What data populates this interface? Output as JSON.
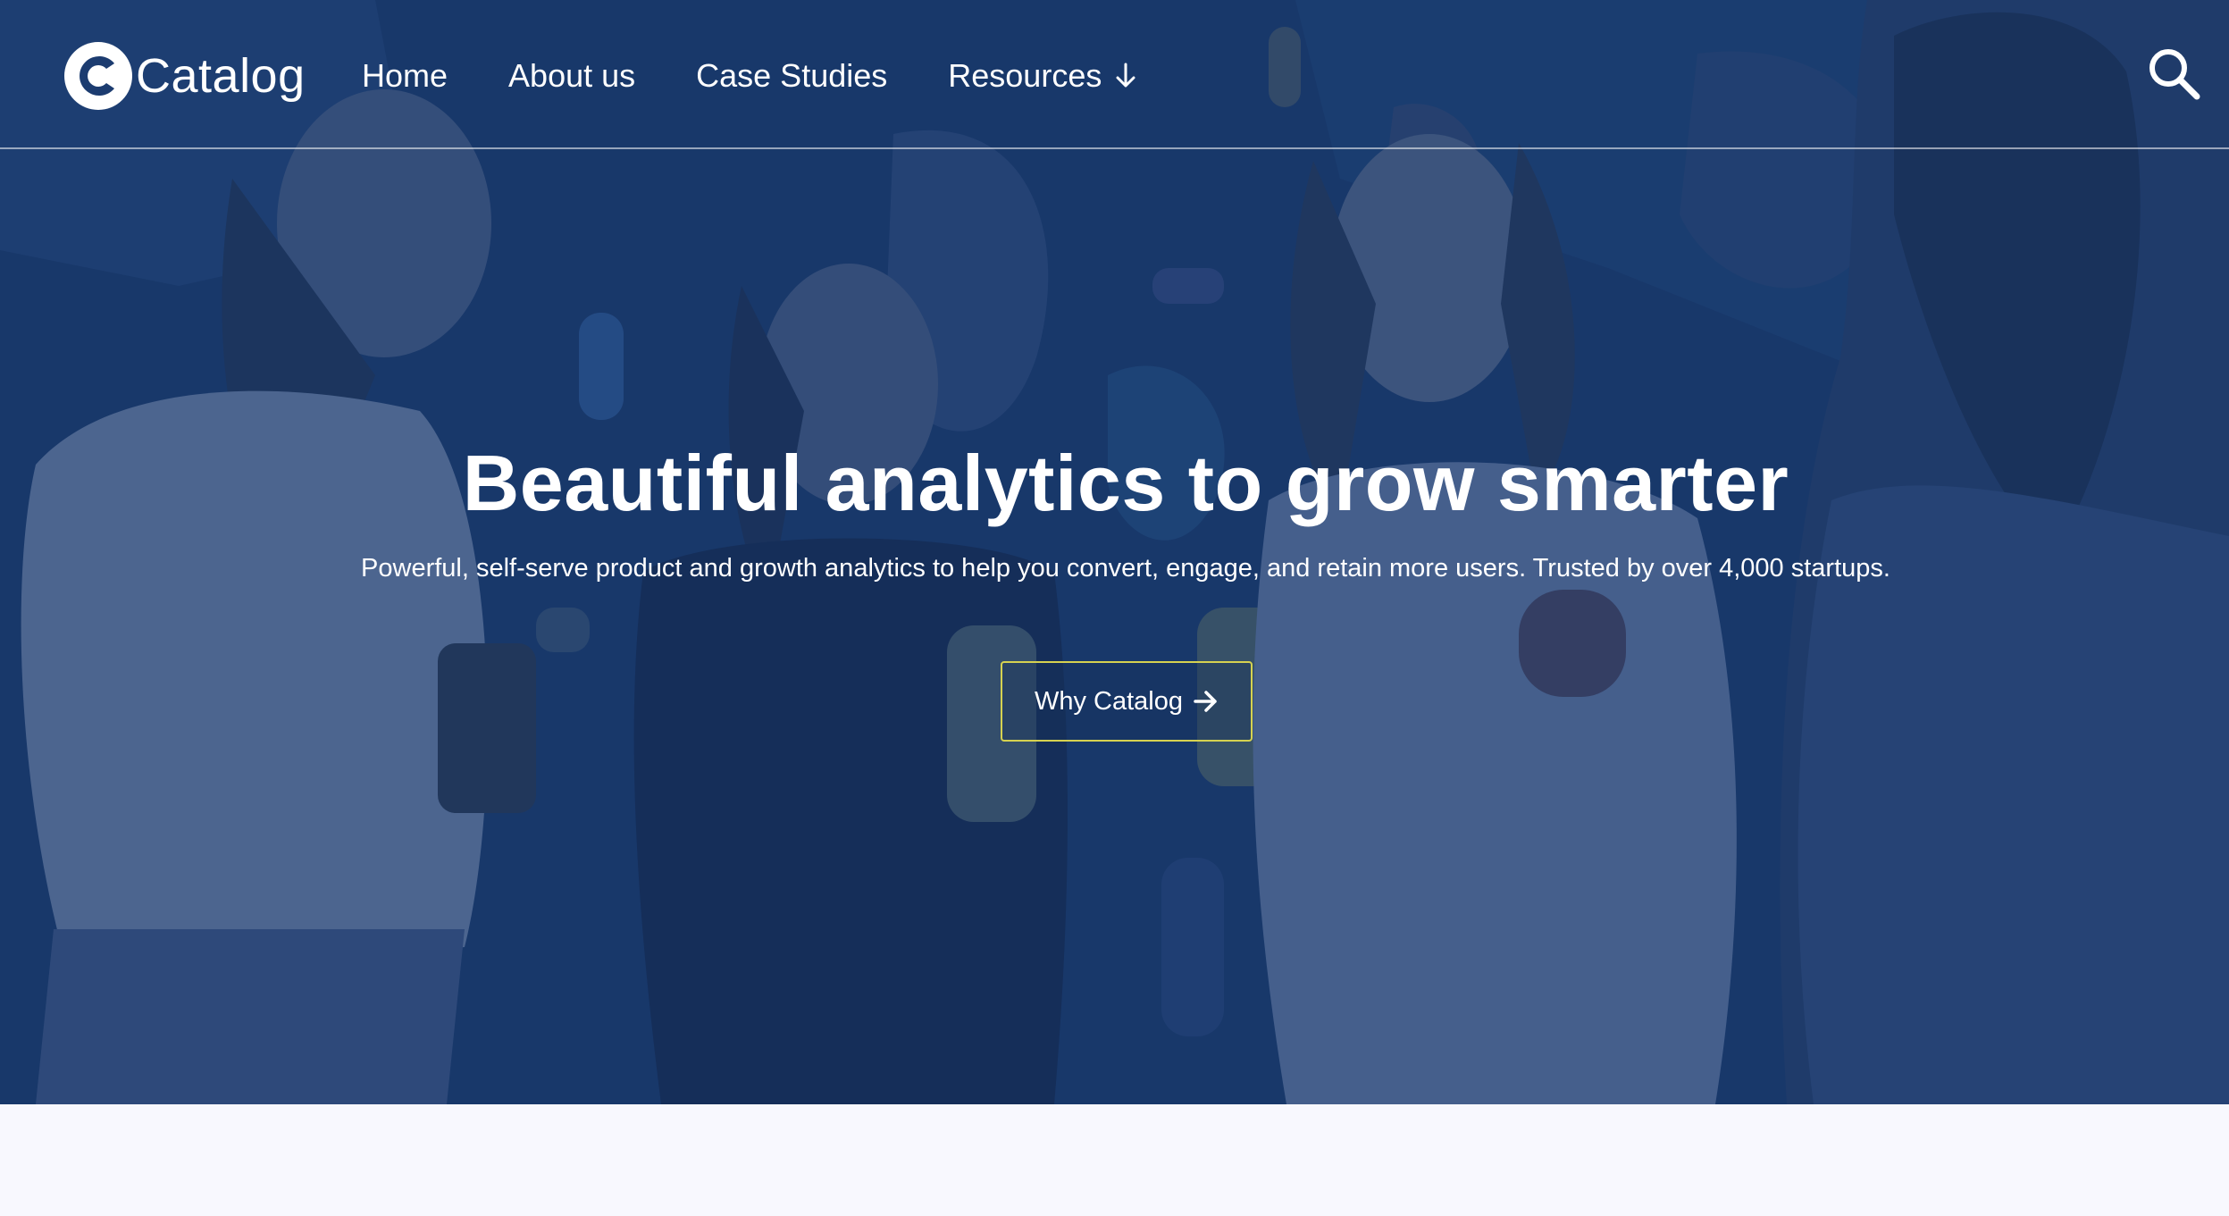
{
  "brand": {
    "name": "Catalog"
  },
  "nav": {
    "items": [
      {
        "label": "Home"
      },
      {
        "label": "About us"
      },
      {
        "label": "Case Studies"
      },
      {
        "label": "Resources"
      }
    ],
    "resources_icon": "arrow-down-icon",
    "search_icon": "search-icon"
  },
  "hero": {
    "headline": "Beautiful analytics to grow smarter",
    "subtext": "Powerful, self-serve product and growth analytics to help you convert, engage, and retain more users. Trusted by over 4,000 startups.",
    "cta_label": "Why Catalog",
    "cta_icon": "arrow-right-icon",
    "image_description_colors": {
      "overlay": "#163466",
      "cta_border": "#d6d250"
    }
  },
  "colors": {
    "text": "#ffffff",
    "page_background": "#f8f8fe"
  }
}
